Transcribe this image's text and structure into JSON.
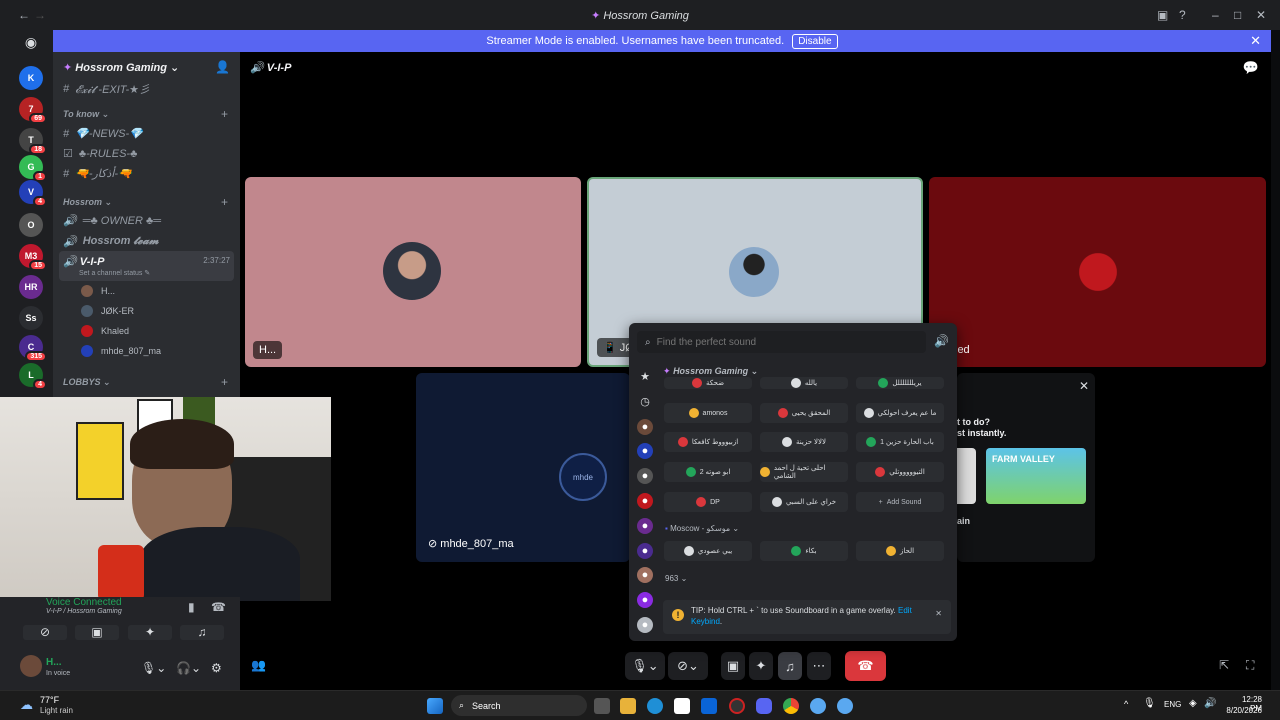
{
  "window": {
    "title": "Hossrom Gaming"
  },
  "banner": {
    "text": "Streamer Mode is enabled. Usernames have been truncated.",
    "disable_label": "Disable"
  },
  "rail": {
    "servers": [
      {
        "label": "K",
        "color": "#1f6feb",
        "badge": ""
      },
      {
        "label": "7",
        "color": "#b62324",
        "badge": "69"
      },
      {
        "label": "T",
        "color": "#444",
        "badge": "18"
      },
      {
        "label": "G",
        "color": "#3b5",
        "badge": "1"
      },
      {
        "label": "V",
        "color": "#2340b8",
        "badge": "4"
      },
      {
        "label": "O",
        "color": "#555",
        "badge": ""
      },
      {
        "label": "M3",
        "color": "#c0182e",
        "badge": "15"
      },
      {
        "label": "HR",
        "color": "#6a2b8f",
        "badge": ""
      },
      {
        "label": "Ss",
        "color": "#2b2d31",
        "badge": ""
      },
      {
        "label": "C",
        "color": "#4a2b8f",
        "badge": "315"
      },
      {
        "label": "L",
        "color": "#1a6b2a",
        "badge": "4"
      }
    ]
  },
  "sidebar": {
    "server_name": "Hossrom Gaming",
    "channels": [
      {
        "name": "𝓔𝔁𝓲𝓽 -EXIT-★彡",
        "kind": "text"
      },
      {
        "category": "To know"
      },
      {
        "name": "💎-NEWS-💎",
        "kind": "text"
      },
      {
        "name": "♣-RULES-♣",
        "kind": "rules"
      },
      {
        "name": "🔫-أذكار-🔫",
        "kind": "text"
      },
      {
        "category": "Hossrom"
      },
      {
        "name": "═♣ OWNER ♣═",
        "kind": "voice"
      },
      {
        "name": "Hossrom 𝓽𝓮𝓪𝓶",
        "kind": "voice"
      },
      {
        "name": "V-I-P",
        "kind": "voice-active",
        "time": "2:37:27",
        "status": "Set a channel status"
      },
      {
        "category": "LOBBYS"
      }
    ],
    "voice_users": [
      {
        "name": "H..."
      },
      {
        "name": "JØK-ER"
      },
      {
        "name": "Khaled"
      },
      {
        "name": "mhde_807_ma"
      }
    ]
  },
  "main": {
    "channel_title": "V-I-P",
    "tiles": [
      {
        "label": "H..."
      },
      {
        "label": "JØK"
      },
      {
        "label": "led"
      },
      {
        "label": "mhde_807_ma"
      }
    ],
    "activity": {
      "text1": "t to do?",
      "text2": "st instantly.",
      "game": "FARM VALLEY",
      "footer": "ain"
    }
  },
  "soundboard": {
    "search_placeholder": "Find the perfect sound",
    "section1": "Hossrom Gaming",
    "sounds_row0": [
      "ضحكة",
      "يالله",
      "يريلللللللل"
    ],
    "sounds_row1": [
      "amonos",
      "المحقق يحيى",
      "ما عم يعرف احولكي"
    ],
    "sounds_row2": [
      "ازبيوووط كافعكا",
      "لالالا حزينة",
      "باب الحارة حزين 1"
    ],
    "sounds_row3": [
      "ابو صوته 2",
      "احلى تحية ل احمد الشامي",
      "التيوووووتلي"
    ],
    "sounds_row4": [
      "DP",
      "خراي على السبي"
    ],
    "add_sound": "Add Sound",
    "section2": "Moscow - موسكو",
    "sounds_row5": [
      "يبي عصودي",
      "بكاء",
      "الحاز"
    ],
    "section3": "963",
    "tip": "TIP: Hold CTRL + ` to use Soundboard in a game overlay.",
    "tip_link": "Edit Keybind",
    "tip_end": "."
  },
  "user_panel": {
    "voice_status": "Voice Connected",
    "voice_location": "V-I-P / Hossrom Gaming",
    "username": "H...",
    "user_status": "In voice"
  },
  "taskbar": {
    "weather_temp": "77°F",
    "weather_desc": "Light rain",
    "search_label": "Search",
    "lang": "ENG",
    "time": "12:28 PM",
    "date": "8/20/2026"
  }
}
